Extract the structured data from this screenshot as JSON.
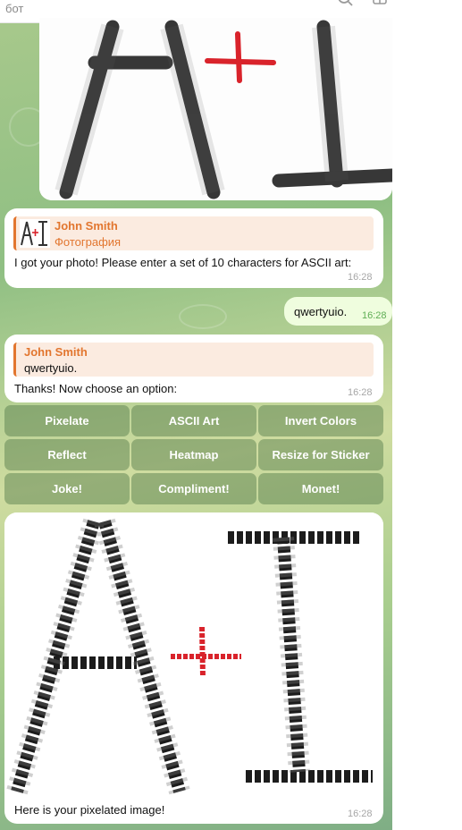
{
  "topbar": {
    "title": "бот"
  },
  "photo_msg": {
    "time": ""
  },
  "msg1": {
    "reply_name": "John Smith",
    "reply_sub": "Фотография",
    "text": "I got your photo! Please enter a set of 10 characters for ASCII art:",
    "time": "16:28"
  },
  "out1": {
    "text": "qwertyuio.",
    "time": "16:28"
  },
  "msg2": {
    "reply_name": "John Smith",
    "reply_sub": "qwertyuio.",
    "text": "Thanks! Now choose an option:",
    "time": "16:28"
  },
  "keyboard": [
    [
      "Pixelate",
      "ASCII Art",
      "Invert Colors"
    ],
    [
      "Reflect",
      "Heatmap",
      "Resize for Sticker"
    ],
    [
      "Joke!",
      "Compliment!",
      "Monet!"
    ]
  ],
  "msg3": {
    "text": "Here is your pixelated image!",
    "time": "16:28"
  },
  "colors": {
    "accent": "#e2762f",
    "out_bubble": "#effdde",
    "keyboard": "#5a8a4f",
    "red_plus": "#d9232b"
  }
}
